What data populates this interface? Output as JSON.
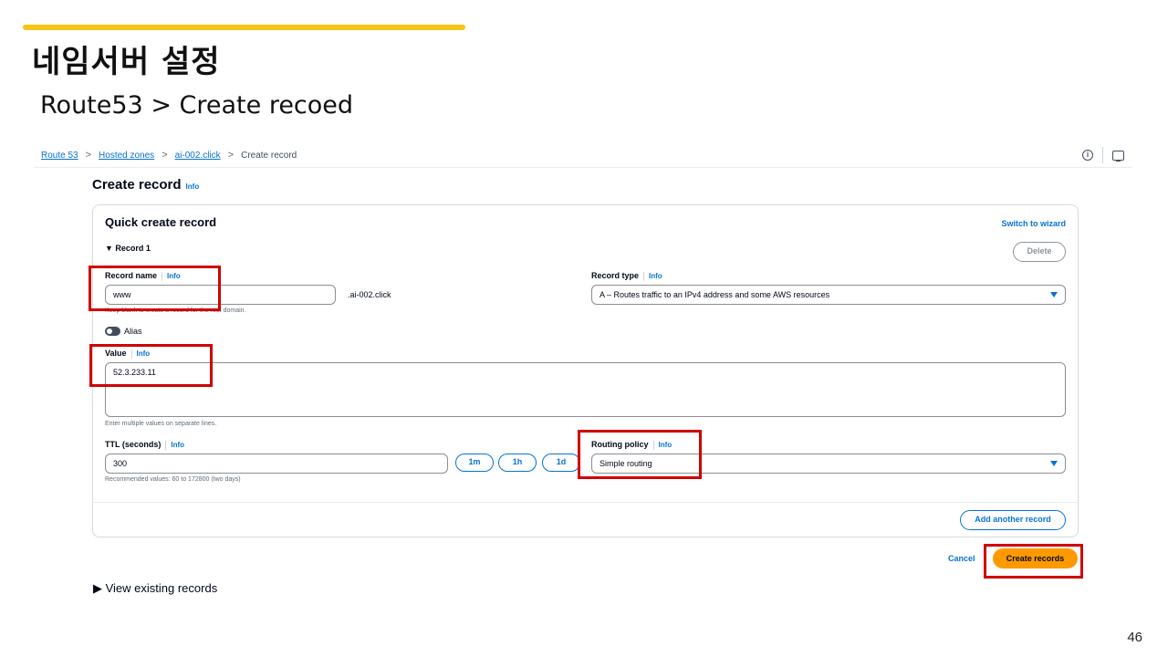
{
  "slide": {
    "title": "네임서버 설정",
    "subtitle": "Route53 > Create recoed",
    "page_number": "46"
  },
  "breadcrumb": {
    "items": [
      "Route 53",
      "Hosted zones",
      "ai-002.click"
    ],
    "current": "Create record",
    "separator": ">"
  },
  "page": {
    "title": "Create record",
    "info": "Info"
  },
  "card": {
    "title": "Quick create record",
    "switch_label": "Switch to wizard",
    "record_label": "▼ Record 1",
    "delete_label": "Delete"
  },
  "record_name": {
    "label": "Record name",
    "info": "Info",
    "value": "www",
    "suffix": ".ai-002.click",
    "hint": "Keep blank to create a record for the root domain."
  },
  "record_type": {
    "label": "Record type",
    "info": "Info",
    "value": "A – Routes traffic to an IPv4 address and some AWS resources"
  },
  "alias": {
    "label": "Alias",
    "enabled": false
  },
  "value_field": {
    "label": "Value",
    "info": "Info",
    "value": "52.3.233.11",
    "hint": "Enter multiple values on separate lines."
  },
  "ttl": {
    "label": "TTL (seconds)",
    "info": "Info",
    "value": "300",
    "hint": "Recommended values: 60 to 172800 (two days)",
    "presets": [
      "1m",
      "1h",
      "1d"
    ]
  },
  "routing_policy": {
    "label": "Routing policy",
    "info": "Info",
    "value": "Simple routing"
  },
  "actions": {
    "add_another": "Add another record",
    "cancel": "Cancel",
    "create": "Create records"
  },
  "view_existing": "▶ View existing records",
  "colors": {
    "accent_bar": "#f5c518",
    "link_blue": "#0972d3",
    "primary_orange": "#ff9900",
    "highlight_red": "#d00000"
  }
}
